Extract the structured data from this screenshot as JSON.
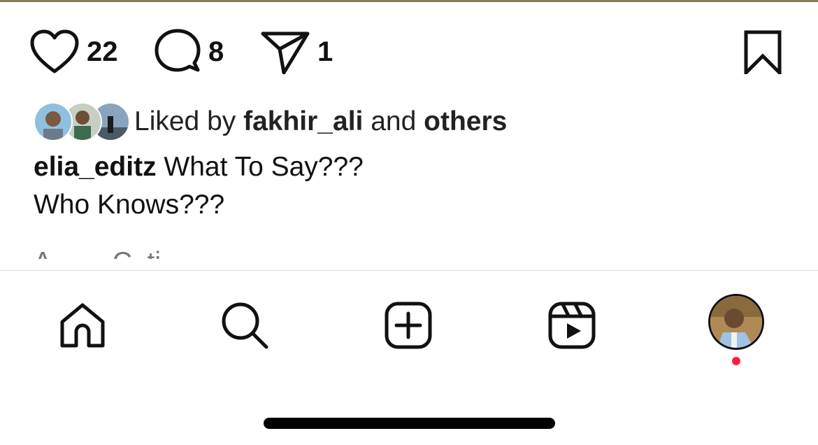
{
  "actions": {
    "likes_count": "22",
    "comments_count": "8",
    "shares_count": "1"
  },
  "liked_by": {
    "prefix": "Liked by",
    "user": "fakhir_ali",
    "connector": "and",
    "others": "others"
  },
  "caption": {
    "username": "elia_editz",
    "line1": "What To Say???",
    "line2": "Who Knows???",
    "partial_line": "A... ... C..ti... "
  },
  "nav": {
    "items": [
      "home-icon",
      "search-icon",
      "create-icon",
      "reels-icon",
      "profile-avatar"
    ]
  },
  "colors": {
    "text": "#111111",
    "notification_dot": "#ff1f3d",
    "divider": "#dcdcdc"
  }
}
